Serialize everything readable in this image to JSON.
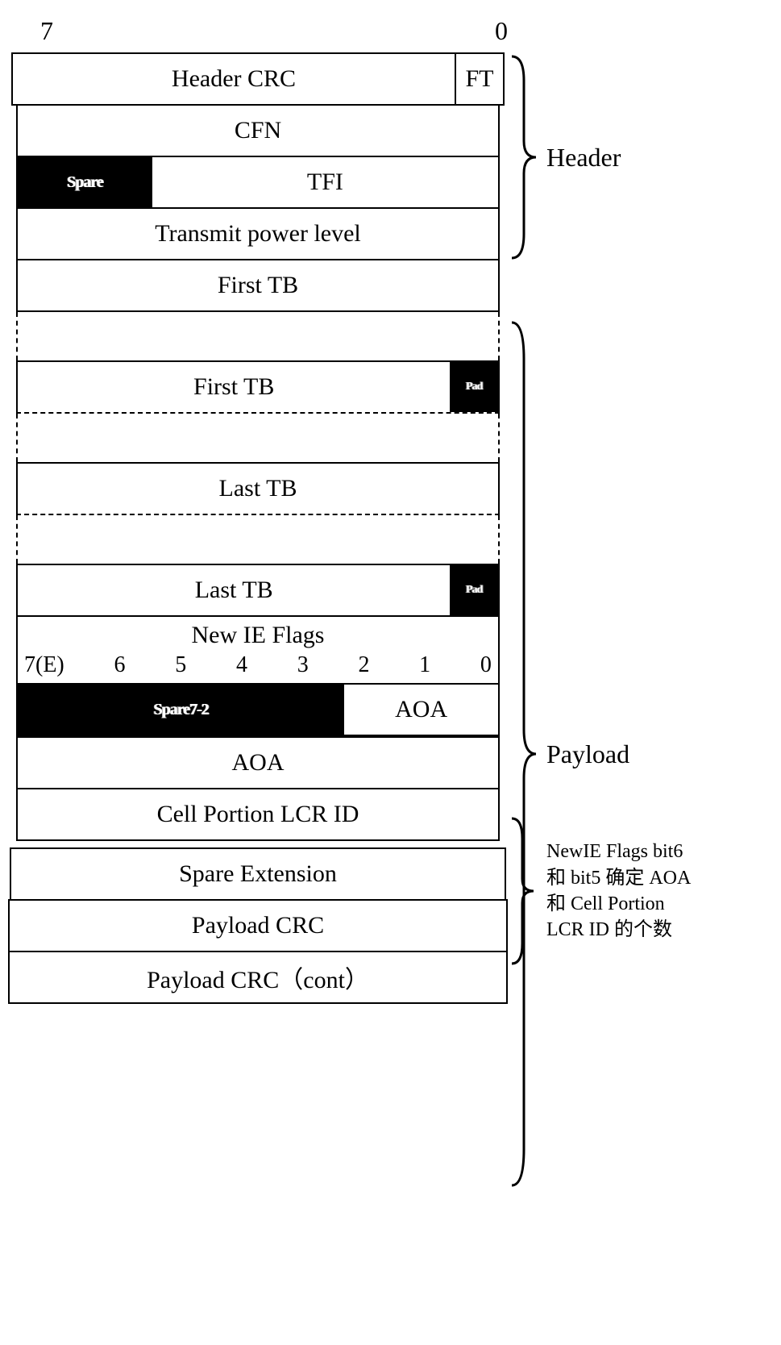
{
  "bits": {
    "msb": "7",
    "lsb": "0"
  },
  "header": {
    "crc": "Header CRC",
    "ft": "FT",
    "cfn": "CFN",
    "spare": "Spare",
    "tfi": "TFI",
    "tx_power": "Transmit power level",
    "label": "Header"
  },
  "payload": {
    "first_tb": "First TB",
    "first_tb_pad": "First TB",
    "pad1": "Pad",
    "last_tb": "Last TB",
    "last_tb_pad": "Last TB",
    "pad2": "Pad",
    "new_ie_flags_title": "New  IE Flags",
    "ie_bits": [
      "7(E)",
      "6",
      "5",
      "4",
      "3",
      "2",
      "1",
      "0"
    ],
    "spare72": "Spare7-2",
    "aoa_short": "AOA",
    "aoa_full": "AOA",
    "cell_portion": "Cell Portion LCR ID",
    "spare_ext": "Spare Extension",
    "payload_crc": "Payload CRC",
    "payload_crc_cont": "Payload CRC（cont）",
    "label": "Payload"
  },
  "note": {
    "line1": "NewIE Flags bit6",
    "line2": "和 bit5 确定 AOA",
    "line3": "和 Cell Portion",
    "line4": "LCR ID 的个数"
  }
}
